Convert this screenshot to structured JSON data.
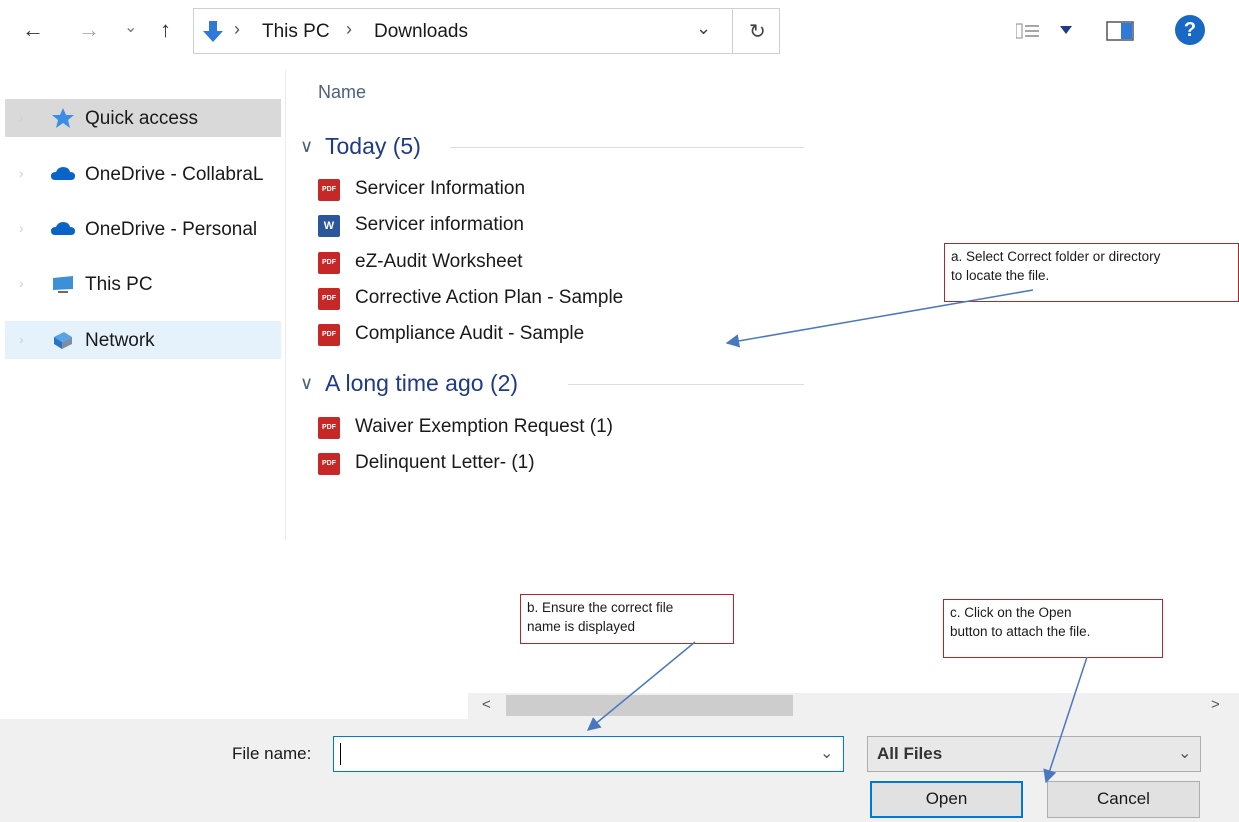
{
  "toolbar": {
    "back": "←",
    "forward": "→",
    "recent": "⌄",
    "up": "↑",
    "refresh": "↻",
    "dropdown": "⌄",
    "help": "?"
  },
  "address": {
    "sep1": "›",
    "this_pc": "This PC",
    "sep2": "›",
    "downloads": "Downloads"
  },
  "column_header": "Name",
  "sidebar": {
    "items": [
      {
        "label": "Quick access"
      },
      {
        "label": "OneDrive - CollabraL"
      },
      {
        "label": "OneDrive - Personal"
      },
      {
        "label": "This PC"
      },
      {
        "label": "Network"
      }
    ]
  },
  "groups": [
    {
      "label": "Today (5)",
      "files": [
        "Servicer Information",
        "Servicer information",
        "eZ-Audit Worksheet",
        "Corrective Action Plan - Sample",
        "Compliance Audit - Sample"
      ]
    },
    {
      "label": "A long time ago (2)",
      "files": [
        "Waiver Exemption Request (1)",
        "Delinquent Letter- (1)"
      ]
    }
  ],
  "file_icons": {
    "pdf": "PDF",
    "word": "W"
  },
  "annotations": {
    "a": {
      "line1": "a. Select Correct folder or directory",
      "line2": "to locate the file."
    },
    "b": {
      "line1": "b. Ensure the correct file",
      "line2": "name is displayed"
    },
    "c": {
      "line1": "c. Click on the Open",
      "line2": "button to attach the file."
    }
  },
  "scroll": {
    "left": "<",
    "right": ">"
  },
  "bottom": {
    "file_name_label": "File name:",
    "file_name_value": "",
    "file_type": "All Files",
    "open": "Open",
    "cancel": "Cancel"
  },
  "colors": {
    "accent": "#0078d7",
    "group_heading": "#1f3a87",
    "annotation_border": "#b3262e",
    "arrow": "#4a78c0"
  }
}
